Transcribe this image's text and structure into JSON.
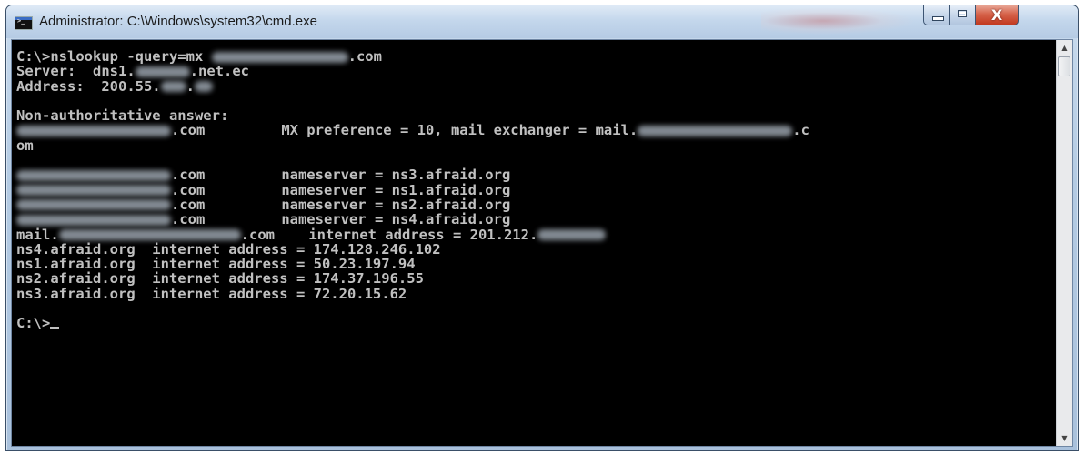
{
  "window": {
    "title": "Administrator: C:\\Windows\\system32\\cmd.exe",
    "icon": "cmd-icon",
    "close_glyph": "X"
  },
  "console": {
    "lines": [
      {
        "segments": [
          {
            "t": "C:\\>nslookup -query=mx "
          },
          {
            "blur": 150
          },
          {
            "t": ".com"
          }
        ]
      },
      {
        "segments": [
          {
            "t": "Server:  dns1."
          },
          {
            "blur": 60
          },
          {
            "t": ".net.ec"
          }
        ]
      },
      {
        "segments": [
          {
            "t": "Address:  200.55."
          },
          {
            "blur": 28
          },
          {
            "t": "."
          },
          {
            "blur": 20
          }
        ]
      },
      {
        "segments": [
          {
            "t": ""
          }
        ]
      },
      {
        "segments": [
          {
            "t": "Non-authoritative answer:"
          }
        ]
      },
      {
        "segments": [
          {
            "blur": 170
          },
          {
            "t": ".com         MX preference = 10, mail exchanger = mail."
          },
          {
            "blur": 170
          },
          {
            "t": ".c"
          }
        ]
      },
      {
        "segments": [
          {
            "t": "om"
          }
        ]
      },
      {
        "segments": [
          {
            "t": ""
          }
        ]
      },
      {
        "segments": [
          {
            "blur": 170
          },
          {
            "t": ".com         nameserver = ns3.afraid.org"
          }
        ]
      },
      {
        "segments": [
          {
            "blur": 170
          },
          {
            "t": ".com         nameserver = ns1.afraid.org"
          }
        ]
      },
      {
        "segments": [
          {
            "blur": 170
          },
          {
            "t": ".com         nameserver = ns2.afraid.org"
          }
        ]
      },
      {
        "segments": [
          {
            "blur": 170
          },
          {
            "t": ".com         nameserver = ns4.afraid.org"
          }
        ]
      },
      {
        "segments": [
          {
            "t": "mail."
          },
          {
            "blur": 200
          },
          {
            "t": ".com    internet address = 201.212."
          },
          {
            "blur": 75
          }
        ]
      },
      {
        "segments": [
          {
            "t": "ns4.afraid.org  internet address = 174.128.246.102"
          }
        ]
      },
      {
        "segments": [
          {
            "t": "ns1.afraid.org  internet address = 50.23.197.94"
          }
        ]
      },
      {
        "segments": [
          {
            "t": "ns2.afraid.org  internet address = 174.37.196.55"
          }
        ]
      },
      {
        "segments": [
          {
            "t": "ns3.afraid.org  internet address = 72.20.15.62"
          }
        ]
      },
      {
        "segments": [
          {
            "t": ""
          }
        ]
      },
      {
        "segments": [
          {
            "t": "C:\\>"
          }
        ],
        "cursor": true
      }
    ]
  },
  "scrollbar": {
    "up_icon": "scroll-up-arrow-icon",
    "down_icon": "scroll-down-arrow-icon"
  }
}
